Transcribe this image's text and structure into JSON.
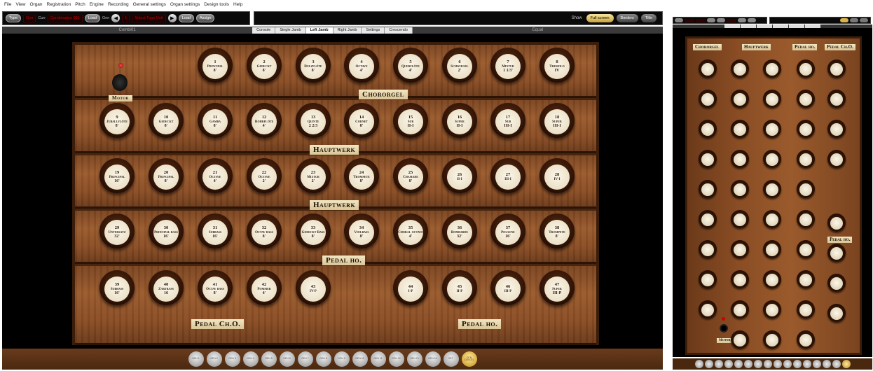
{
  "menu": [
    "File",
    "View",
    "Organ",
    "Registration",
    "Pitch",
    "Engine",
    "Recording",
    "General settings",
    "Organ settings",
    "Design tools",
    "Help"
  ],
  "toolbar": {
    "type_label": "Type",
    "mode": "Gen",
    "curr_label": "Curr",
    "curr_value": "Combination 001",
    "load1": "Load",
    "gen_label": "Gen",
    "gen_value": "1",
    "next_value": "Select Tune Unit",
    "load2": "Load",
    "assign": "Assign"
  },
  "view": {
    "show_label": "Show",
    "options": [
      {
        "label": "Full screen",
        "active": true
      },
      {
        "label": "Borders",
        "active": false
      },
      {
        "label": "Title",
        "active": false
      }
    ]
  },
  "tabs": {
    "left_side": "Combi01",
    "right_side": "Equal",
    "items": [
      {
        "label": "Console",
        "active": false
      },
      {
        "label": "Single Jamb",
        "active": false
      },
      {
        "label": "Left Jamb",
        "active": true
      },
      {
        "label": "Right Jamb",
        "active": false
      },
      {
        "label": "Settings",
        "active": false
      },
      {
        "label": "Crescendo",
        "active": false
      }
    ]
  },
  "motor": {
    "label": "Motor"
  },
  "divisions": {
    "chororgel": "Chororgel",
    "hauptwerk1": "Hauptwerk",
    "hauptwerk2": "Hauptwerk",
    "pedal_ho1": "Pedal ho.",
    "pedal_ch": "Pedal Ch.O.",
    "pedal_ho2": "Pedal ho."
  },
  "rows": [
    [
      {
        "n": "1",
        "name": "Principal",
        "foot": "8'"
      },
      {
        "n": "2",
        "name": "Gedeckt",
        "foot": "8'"
      },
      {
        "n": "3",
        "name": "Dulzflöte",
        "foot": "8'"
      },
      {
        "n": "4",
        "name": "Octave",
        "foot": "4'"
      },
      {
        "n": "5",
        "name": "Querflöte",
        "foot": "4'"
      },
      {
        "n": "6",
        "name": "Schwiegel",
        "foot": "2'"
      },
      {
        "n": "7",
        "name": "Mixtur",
        "foot": "1 1/3'"
      },
      {
        "n": "8",
        "name": "Tremolo",
        "foot": "IV"
      }
    ],
    [
      {
        "n": "9",
        "name": "Juballflöte",
        "foot": "8'"
      },
      {
        "n": "10",
        "name": "Gedeckt",
        "foot": "8'"
      },
      {
        "n": "11",
        "name": "Gamba",
        "foot": "8'"
      },
      {
        "n": "12",
        "name": "Rohrflöte",
        "foot": "4'"
      },
      {
        "n": "13",
        "name": "Quinte",
        "foot": "2 2/3"
      },
      {
        "n": "14",
        "name": "Cornet",
        "foot": "8'"
      },
      {
        "n": "15",
        "name": "Sub",
        "foot": "II-I"
      },
      {
        "n": "16",
        "name": "Super",
        "foot": "II-I"
      },
      {
        "n": "17",
        "name": "Sub",
        "foot": "III-I"
      },
      {
        "n": "18",
        "name": "Super",
        "foot": "III-I"
      }
    ],
    [
      {
        "n": "19",
        "name": "Principal",
        "foot": "16'"
      },
      {
        "n": "20",
        "name": "Principal",
        "foot": "8'"
      },
      {
        "n": "21",
        "name": "Octave",
        "foot": "4'"
      },
      {
        "n": "22",
        "name": "Octave",
        "foot": "2'"
      },
      {
        "n": "23",
        "name": "Mixtur",
        "foot": "2'"
      },
      {
        "n": "24",
        "name": "Trompete",
        "foot": "8'"
      },
      {
        "n": "25",
        "name": "Chamade",
        "foot": "8'"
      },
      {
        "n": "26",
        "name": "II-I",
        "foot": ""
      },
      {
        "n": "27",
        "name": "III-I",
        "foot": ""
      },
      {
        "n": "28",
        "name": "IV-I",
        "foot": ""
      }
    ],
    [
      {
        "n": "29",
        "name": "Untersatz",
        "foot": "32'"
      },
      {
        "n": "30",
        "name": "Principal bass",
        "foot": "16'"
      },
      {
        "n": "31",
        "name": "Subbass",
        "foot": "16'"
      },
      {
        "n": "32",
        "name": "Octav bass",
        "foot": "8'"
      },
      {
        "n": "33",
        "name": "Gedeckt Bass",
        "foot": "8'"
      },
      {
        "n": "34",
        "name": "Violbass",
        "foot": "8'"
      },
      {
        "n": "35",
        "name": "Choral octave",
        "foot": "4'"
      },
      {
        "n": "36",
        "name": "Bombarde",
        "foot": "32'"
      },
      {
        "n": "37",
        "name": "Posaune",
        "foot": "16'"
      },
      {
        "n": "38",
        "name": "Trompete",
        "foot": "8'"
      }
    ],
    [
      {
        "n": "39",
        "name": "Subbass",
        "foot": "16'"
      },
      {
        "n": "40",
        "name": "Zartbass",
        "foot": "16"
      },
      {
        "n": "41",
        "name": "Octav bass",
        "foot": "8'"
      },
      {
        "n": "42",
        "name": "Pommer",
        "foot": "4'"
      },
      {
        "n": "43",
        "name": "IV-P",
        "foot": ""
      },
      {
        "n": "44",
        "name": "I-P",
        "foot": ""
      },
      {
        "n": "45",
        "name": "II-P",
        "foot": ""
      },
      {
        "n": "46",
        "name": "III-P",
        "foot": ""
      },
      {
        "n": "47",
        "name": "Super",
        "foot": "III-P"
      }
    ]
  ],
  "pistons": [
    "GEN 1",
    "GEN 2",
    "GEN 3",
    "GEN 4",
    "GEN 5",
    "GEN 6",
    "GEN 7",
    "GEN 8",
    "GEN 9",
    "GEN 10",
    "GEN 11",
    "GEN 12",
    "GEN 13",
    "GEN 14",
    "SET",
    "GEN CANCEL"
  ],
  "side": {
    "chororgel": "Chororgel",
    "hauptwerk": "Hauptwerk",
    "pedal_ho": "Pedal ho.",
    "pedal_ch": "Pedal Ch.O.",
    "pedal_ho2": "Pedal ho.",
    "motor": "Motor"
  }
}
